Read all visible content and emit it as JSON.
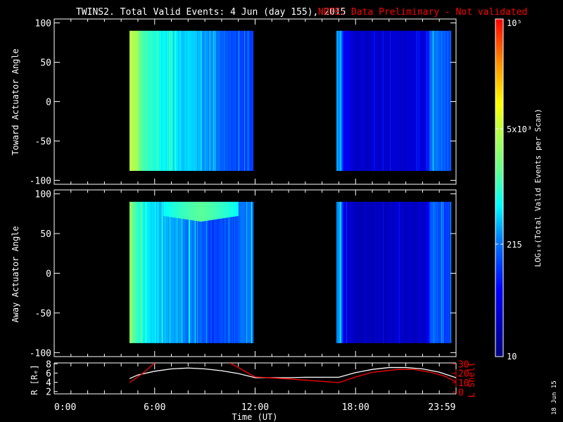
{
  "title": "TWINS2. Total Valid Events:  4 Jun (day 155), 2015",
  "note": "NOTE: Data Preliminary - Not validated",
  "stamp": "18 Jun 15",
  "colors": {
    "note": "#ff0000",
    "lshell": "#ff0000",
    "radius": "#ffffff",
    "axes": "#ffffff"
  },
  "chart_data": [
    {
      "type": "heatmap",
      "name": "toward",
      "ylabel": "Toward Actuator Angle",
      "ylim": [
        -105,
        105
      ],
      "yticks": [
        100,
        50,
        0,
        -50,
        -100
      ],
      "ytick_labels": [
        "100",
        "50",
        "0",
        "-50",
        "-100"
      ],
      "angle_range": [
        -88,
        90
      ],
      "segments": [
        {
          "start": 4.5,
          "end": 11.9,
          "profile_hours": [
            4.5,
            4.7,
            5.2,
            6.0,
            7.0,
            8.5,
            9.5,
            10.5,
            11.9
          ],
          "profile_counts": [
            6000,
            4500,
            1500,
            800,
            600,
            400,
            250,
            150,
            120
          ]
        },
        {
          "start": 16.85,
          "end": 23.7,
          "profile_hours": [
            16.85,
            17.1,
            17.3,
            18,
            20,
            22.2,
            22.5,
            23,
            23.7
          ],
          "profile_counts": [
            300,
            400,
            60,
            30,
            30,
            40,
            250,
            200,
            150
          ]
        }
      ],
      "band": null
    },
    {
      "type": "heatmap",
      "name": "away",
      "ylabel": "Away Actuator Angle",
      "ylim": [
        -105,
        105
      ],
      "yticks": [
        100,
        50,
        0,
        -50,
        -100
      ],
      "ytick_labels": [
        "100",
        "50",
        "0",
        "-50",
        "-100"
      ],
      "angle_range": [
        -88,
        90
      ],
      "segments": [
        {
          "start": 4.5,
          "end": 11.9,
          "profile_hours": [
            4.5,
            4.7,
            5.2,
            6.0,
            7.0,
            8.5,
            9.5,
            10.5,
            11.9
          ],
          "profile_counts": [
            3000,
            1500,
            700,
            500,
            350,
            200,
            120,
            150,
            250
          ]
        },
        {
          "start": 16.85,
          "end": 23.7,
          "profile_hours": [
            16.85,
            17.1,
            17.3,
            18,
            20,
            22.2,
            22.5,
            23,
            23.7
          ],
          "profile_counts": [
            250,
            300,
            40,
            25,
            25,
            30,
            200,
            150,
            120
          ]
        }
      ],
      "band": {
        "start": 6.5,
        "end": 11.0,
        "angle_min": 65,
        "angle_max": 90,
        "counts": 1500
      }
    },
    {
      "type": "line",
      "name": "orbit",
      "xlabel": "Time (UT)",
      "xlim": [
        0,
        24
      ],
      "xticks": [
        0,
        6,
        12,
        18,
        23.98
      ],
      "xtick_labels": [
        "0:00",
        "6:00",
        "12:00",
        "18:00",
        "23:59"
      ],
      "ylabel": "R [Rₑ]",
      "ylim": [
        1.5,
        8.2
      ],
      "yticks": [
        2,
        4,
        6,
        8
      ],
      "ytick_labels": [
        "2",
        "4",
        "6",
        "8"
      ],
      "y2label": "L Shell",
      "y2lim": [
        -2,
        31
      ],
      "y2ticks": [
        0,
        10,
        20,
        30
      ],
      "y2tick_labels": [
        "0",
        "10",
        "20",
        "30"
      ],
      "series": [
        {
          "name": "R",
          "axis": "left",
          "x": [
            4.5,
            5,
            6,
            7,
            8,
            9,
            10,
            11,
            12,
            14,
            15,
            17,
            18,
            19,
            20,
            21,
            22,
            23,
            24
          ],
          "y": [
            4.8,
            5.6,
            6.4,
            6.9,
            7.1,
            6.9,
            6.5,
            5.9,
            5.0,
            5.0,
            5.1,
            5.1,
            6.1,
            6.8,
            7.2,
            7.2,
            6.9,
            6.2,
            5.0
          ]
        },
        {
          "name": "L Shell",
          "axis": "right",
          "segments": [
            {
              "x": [
                4.5,
                5.3,
                6.0
              ],
              "y": [
                10,
                20,
                31
              ]
            },
            {
              "x": [
                10.5,
                12,
                14,
                17,
                18,
                19,
                20.5,
                21.5,
                22.5,
                23.3,
                24
              ],
              "y": [
                31,
                16,
                14,
                10,
                16,
                21,
                24,
                24,
                21,
                17,
                11
              ]
            }
          ]
        }
      ]
    }
  ],
  "colorbar": {
    "label": "LOG₁₀(Total Valid Events per Scan)",
    "range": [
      10,
      100000
    ],
    "ticks": [
      100000,
      5000,
      215,
      10
    ],
    "tick_labels": [
      "10⁵",
      "5x10³",
      "215",
      "10"
    ]
  }
}
